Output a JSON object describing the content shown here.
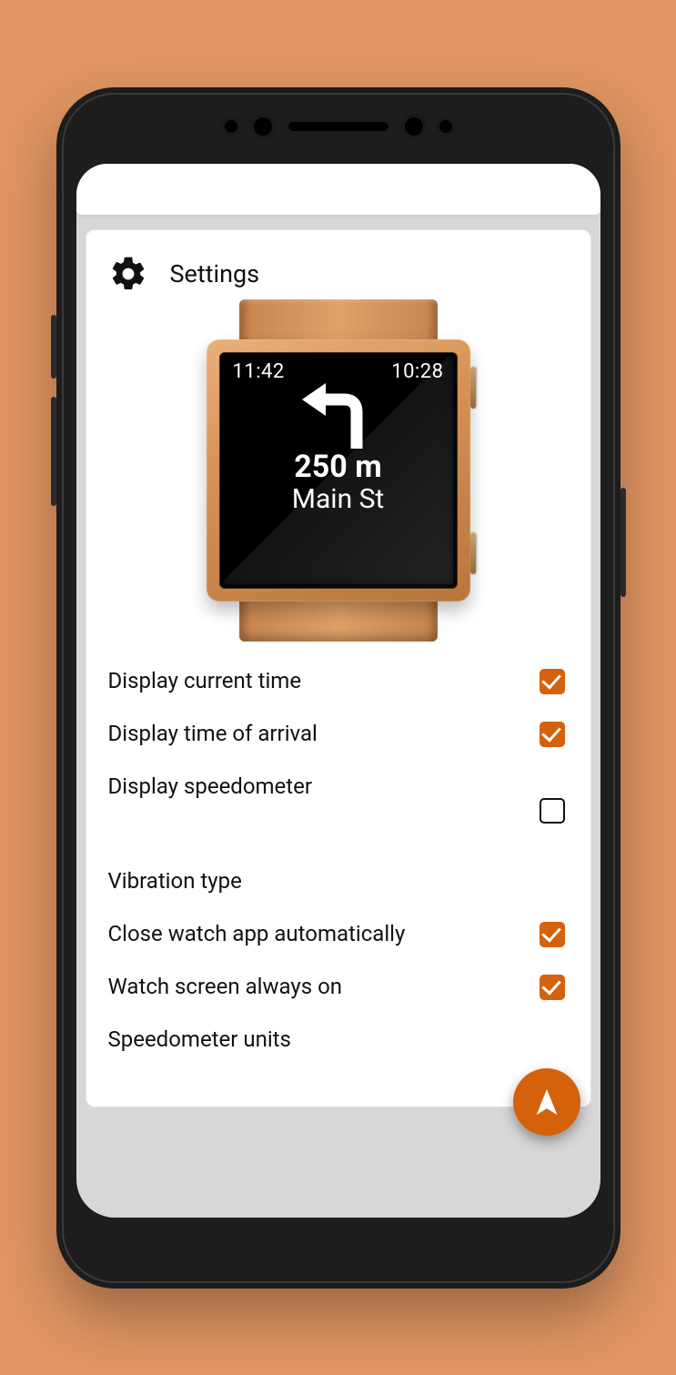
{
  "colors": {
    "accent": "#d4610b",
    "background": "#e09562"
  },
  "header": {
    "title": "Settings"
  },
  "watch": {
    "time_current": "11:42",
    "time_arrival": "10:28",
    "distance": "250 m",
    "street": "Main St"
  },
  "settings": {
    "items": [
      {
        "label": "Display current time",
        "type": "checkbox",
        "checked": true
      },
      {
        "label": "Display time of arrival",
        "type": "checkbox",
        "checked": true
      },
      {
        "label": "Display speedometer",
        "type": "checkbox",
        "checked": false
      },
      {
        "label": "Vibration type",
        "type": "link"
      },
      {
        "label": "Close watch app automatically",
        "type": "checkbox",
        "checked": true
      },
      {
        "label": "Watch screen always on",
        "type": "checkbox",
        "checked": true
      },
      {
        "label": "Speedometer units",
        "type": "link"
      }
    ]
  },
  "fab": {
    "icon": "navigation-arrow-icon"
  }
}
